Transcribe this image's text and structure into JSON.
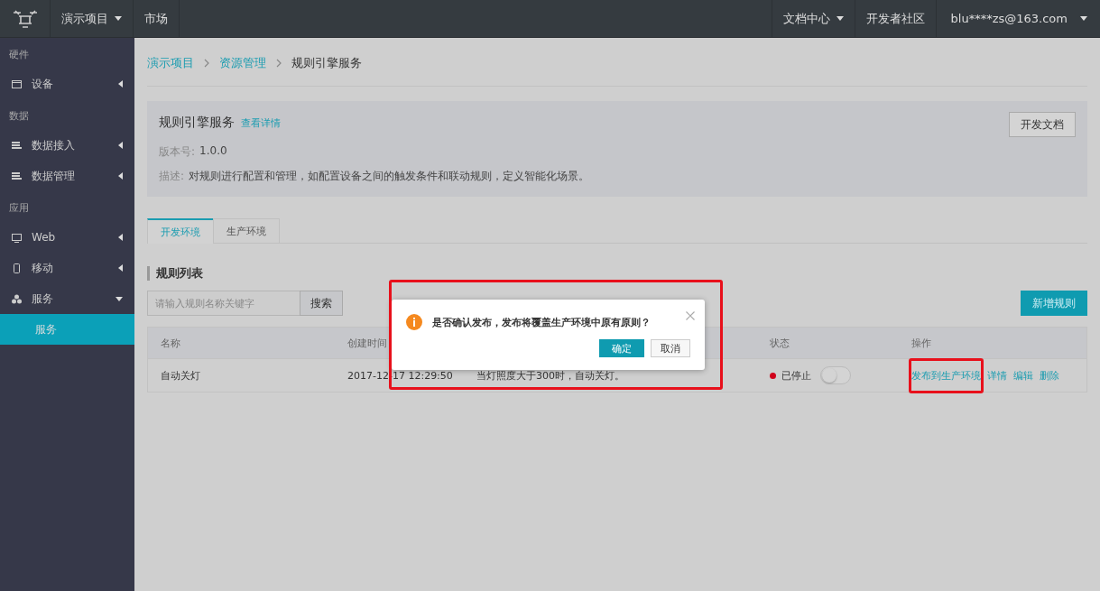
{
  "topbar": {
    "project_menu": "演示项目",
    "links": [
      {
        "label": "市场"
      }
    ],
    "right": [
      {
        "label": "文档中心",
        "kind": "dropdown"
      },
      {
        "label": "开发者社区",
        "kind": "link"
      },
      {
        "label": "blu****zs@163.com",
        "kind": "dropdown"
      }
    ]
  },
  "sidebar": {
    "groups": [
      {
        "title": "硬件",
        "items": [
          {
            "label": "设备",
            "kind": "window",
            "expanded": false
          }
        ]
      },
      {
        "title": "数据",
        "items": [
          {
            "label": "数据接入",
            "kind": "list",
            "expanded": false
          },
          {
            "label": "数据管理",
            "kind": "list",
            "expanded": false
          }
        ]
      },
      {
        "title": "应用",
        "items": [
          {
            "label": "Web",
            "kind": "monitor",
            "expanded": false
          },
          {
            "label": "移动",
            "kind": "phone",
            "expanded": false
          },
          {
            "label": "服务",
            "kind": "cluster",
            "expanded": true,
            "children": [
              {
                "label": "服务",
                "selected": true
              }
            ]
          }
        ]
      }
    ]
  },
  "breadcrumb": [
    {
      "label": "演示项目",
      "link": true
    },
    {
      "label": "资源管理",
      "link": true
    },
    {
      "label": "规则引擎服务",
      "link": false
    }
  ],
  "service": {
    "title": "规则引擎服务",
    "details_link": "查看详情",
    "doc_button": "开发文档",
    "version_label": "版本号:",
    "version": "1.0.0",
    "description_label": "描述:",
    "description": "对规则进行配置和管理，如配置设备之间的触发条件和联动规则，定义智能化场景。"
  },
  "tabs": [
    {
      "label": "开发环境",
      "selected": true
    },
    {
      "label": "生产环境",
      "selected": false
    }
  ],
  "rule_list": {
    "title": "规则列表",
    "search_placeholder": "请输入规则名称关键字",
    "search_button": "搜索",
    "add_button": "新增规则",
    "columns": [
      "名称",
      "创建时间",
      "",
      "状态",
      "操作"
    ],
    "rows": [
      {
        "name": "自动关灯",
        "created": "2017-12-17 12:29:50",
        "description": "当灯照度大于300时，自动关灯。",
        "status": "已停止",
        "color": "#d0021b",
        "on": false,
        "actions": [
          {
            "label": "发布到生产环境",
            "highlighted": true
          },
          {
            "label": "详情",
            "highlighted": false
          },
          {
            "label": "编辑",
            "highlighted": false
          },
          {
            "label": "删除",
            "highlighted": false
          }
        ]
      }
    ]
  },
  "dialog": {
    "message": "是否确认发布，发布将覆盖生产环境中原有原则？",
    "ok": "确定",
    "cancel": "取消",
    "highlighted": true
  }
}
